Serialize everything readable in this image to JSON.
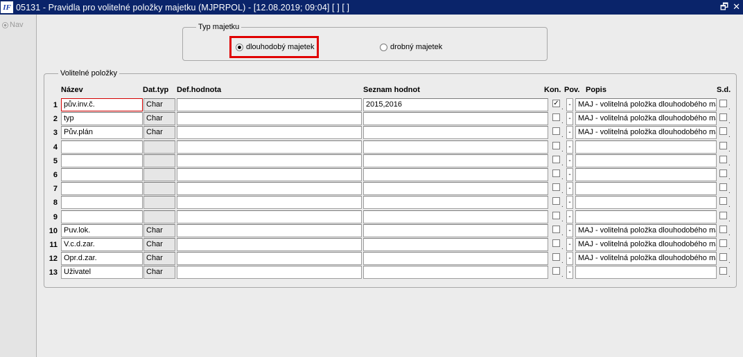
{
  "window": {
    "title": "05131 - Pravidla pro volitelné položky majetku (MJPRPOL) - [12.08.2019; 09:04]  [ ]  [ ]",
    "logo": "IF",
    "restore_glyph": "🗗",
    "close_glyph": "✕"
  },
  "nav": {
    "label": "Nav"
  },
  "typ_majetku": {
    "legend": "Typ majetku",
    "options": [
      {
        "label": "dlouhodobý majetek",
        "selected": true
      },
      {
        "label": "drobný majetek",
        "selected": false
      }
    ]
  },
  "volitelne": {
    "legend": "Volitelné položky",
    "headers": {
      "nazev": "Název",
      "dattyp": "Dat.typ",
      "defhodnota": "Def.hodnota",
      "seznam": "Seznam hodnot",
      "kon": "Kon.",
      "pov": "Pov.",
      "popis": "Popis",
      "sd": "S.d."
    },
    "rows": [
      {
        "n": "1",
        "nazev": "pův.inv.č.",
        "dattyp": "Char",
        "def": "",
        "seznam": "2015,2016",
        "kon": true,
        "pov": "-",
        "popis": "MAJ - volitelná položka dlouhodobého maj",
        "sd": false
      },
      {
        "n": "2",
        "nazev": "typ",
        "dattyp": "Char",
        "def": "",
        "seznam": "",
        "kon": false,
        "pov": "-",
        "popis": "MAJ - volitelná položka dlouhodobého maj",
        "sd": false
      },
      {
        "n": "3",
        "nazev": "Pův.plán",
        "dattyp": "Char",
        "def": "",
        "seznam": "",
        "kon": false,
        "pov": "-",
        "popis": "MAJ - volitelná položka dlouhodobého maj",
        "sd": false
      },
      {
        "n": "4",
        "nazev": "",
        "dattyp": "",
        "def": "",
        "seznam": "",
        "kon": false,
        "pov": "-",
        "popis": "",
        "sd": false
      },
      {
        "n": "5",
        "nazev": "",
        "dattyp": "",
        "def": "",
        "seznam": "",
        "kon": false,
        "pov": "-",
        "popis": "",
        "sd": false
      },
      {
        "n": "6",
        "nazev": "",
        "dattyp": "",
        "def": "",
        "seznam": "",
        "kon": false,
        "pov": "-",
        "popis": "",
        "sd": false
      },
      {
        "n": "7",
        "nazev": "",
        "dattyp": "",
        "def": "",
        "seznam": "",
        "kon": false,
        "pov": "-",
        "popis": "",
        "sd": false
      },
      {
        "n": "8",
        "nazev": "",
        "dattyp": "",
        "def": "",
        "seznam": "",
        "kon": false,
        "pov": "-",
        "popis": "",
        "sd": false
      },
      {
        "n": "9",
        "nazev": "",
        "dattyp": "",
        "def": "",
        "seznam": "",
        "kon": false,
        "pov": "-",
        "popis": "",
        "sd": false
      },
      {
        "n": "10",
        "nazev": "Puv.lok.",
        "dattyp": "Char",
        "def": "",
        "seznam": "",
        "kon": false,
        "pov": "-",
        "popis": "MAJ - volitelná položka dlouhodobého maj",
        "sd": false
      },
      {
        "n": "11",
        "nazev": "V.c.d.zar.",
        "dattyp": "Char",
        "def": "",
        "seznam": "",
        "kon": false,
        "pov": "-",
        "popis": "MAJ - volitelná položka dlouhodobého maj",
        "sd": false
      },
      {
        "n": "12",
        "nazev": "Opr.d.zar.",
        "dattyp": "Char",
        "def": "",
        "seznam": "",
        "kon": false,
        "pov": "-",
        "popis": "MAJ - volitelná položka dlouhodobého maj",
        "sd": false
      },
      {
        "n": "13",
        "nazev": "Uživatel",
        "dattyp": "Char",
        "def": "",
        "seznam": "",
        "kon": false,
        "pov": "-",
        "popis": "",
        "sd": false
      }
    ]
  }
}
